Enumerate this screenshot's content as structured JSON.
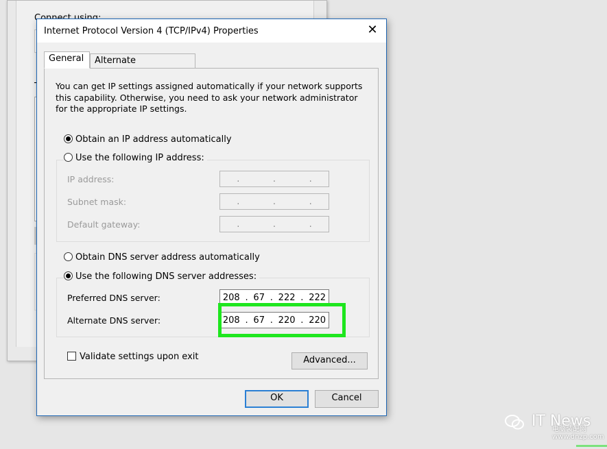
{
  "background_window": {
    "label_connect": "Connect using:",
    "label_this": "Th",
    "label_d": "D",
    "checkboxes": [
      "✔",
      "✔",
      "✔",
      "✔",
      "✔",
      "",
      ""
    ]
  },
  "dialog": {
    "title": "Internet Protocol Version 4 (TCP/IPv4) Properties",
    "close_symbol": "✕",
    "tabs": {
      "general": "General",
      "alternate": "Alternate Configuration"
    },
    "info_text": "You can get IP settings assigned automatically if your network supports this capability. Otherwise, you need to ask your network administrator for the appropriate IP settings.",
    "ip_auto": {
      "label": "Obtain an IP address automatically",
      "selected": true
    },
    "ip_manual": {
      "label": "Use the following IP address:",
      "selected": false
    },
    "ip_fields": {
      "ip_address": {
        "label": "IP address:",
        "value": [
          ".",
          ".",
          "."
        ]
      },
      "subnet_mask": {
        "label": "Subnet mask:",
        "value": [
          ".",
          ".",
          "."
        ]
      },
      "default_gateway": {
        "label": "Default gateway:",
        "value": [
          ".",
          ".",
          "."
        ]
      }
    },
    "dns_auto": {
      "label": "Obtain DNS server address automatically",
      "selected": false
    },
    "dns_manual": {
      "label": "Use the following DNS server addresses:",
      "selected": true
    },
    "preferred_dns": {
      "label": "Preferred DNS server:",
      "octets": [
        "208",
        "67",
        "222",
        "222"
      ]
    },
    "alternate_dns": {
      "label": "Alternate DNS server:",
      "octets": [
        "208",
        "67",
        "220",
        "220"
      ]
    },
    "validate": {
      "label": "Validate settings upon exit",
      "checked": false
    },
    "advanced_label": "Advanced...",
    "ok_label": "OK",
    "cancel_label": "Cancel"
  },
  "watermark": {
    "title": "IT News",
    "sub": "电脑装配网 www.dnzp.com"
  },
  "colors": {
    "highlight": "#1ee61e",
    "dialog_border": "#1e66b4",
    "default_button_border": "#2a7fd4"
  }
}
